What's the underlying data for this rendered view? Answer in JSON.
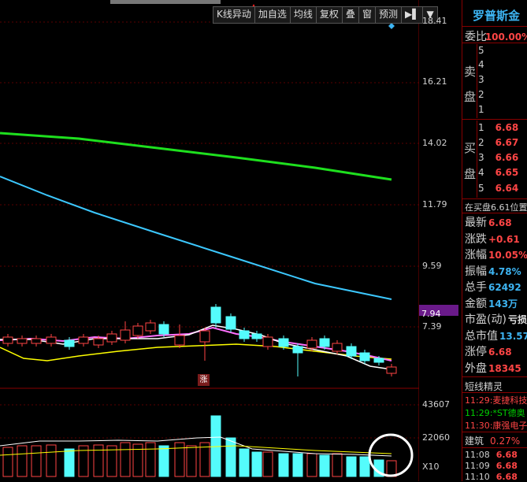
{
  "toolbar": {
    "buttons": [
      "K线异动",
      "加自选",
      "均线",
      "复权",
      "叠",
      "窗",
      "预测"
    ]
  },
  "price_axis": [
    "18.41",
    "16.21",
    "14.02",
    "11.79",
    "9.59",
    "7.39"
  ],
  "current_price_marker": "7.94",
  "volume_axis": [
    "43607",
    "22060",
    "X10"
  ],
  "badge": "涨",
  "stock_name": "罗普斯金",
  "order_book": {
    "weibi_label": "委比",
    "weibi_value": "100.00%",
    "sell_label_1": "卖",
    "sell_label_2": "盘",
    "sell_levels": [
      "5",
      "4",
      "3",
      "2",
      "1"
    ],
    "buy_label_1": "买",
    "buy_label_2": "盘",
    "buy_levels": [
      {
        "n": "1",
        "price": "6.68"
      },
      {
        "n": "2",
        "price": "6.67"
      },
      {
        "n": "3",
        "price": "6.66"
      },
      {
        "n": "4",
        "price": "6.65"
      },
      {
        "n": "5",
        "price": "6.64"
      }
    ],
    "buy_position": "在买盘6.61位置"
  },
  "quote": [
    {
      "label": "最新",
      "value": "6.68",
      "color": "red"
    },
    {
      "label": "涨跌",
      "value": "+0.61",
      "color": "red"
    },
    {
      "label": "涨幅",
      "value": "10.05%",
      "color": "red"
    },
    {
      "label": "振幅",
      "value": "4.78%",
      "color": "cyan"
    },
    {
      "label": "总手",
      "value": "62492",
      "color": "cyan"
    },
    {
      "label": "金额",
      "value": "143万",
      "color": "cyan"
    },
    {
      "label": "市盈(动)",
      "value": "亏损",
      "color": "white"
    },
    {
      "label": "总市值",
      "value": "13.57亿",
      "color": "cyan"
    },
    {
      "label": "涨停",
      "value": "6.68",
      "color": "red"
    },
    {
      "label": "外盘",
      "value": "18345",
      "color": "red"
    }
  ],
  "short_genius": {
    "title": "短线精灵",
    "items": [
      {
        "time": "11:29",
        "text": ":麦捷科技",
        "color": "red"
      },
      {
        "time": "11:29",
        "text": ":*ST德奥",
        "color": "green"
      },
      {
        "time": "11:30",
        "text": ":康强电子",
        "color": "red"
      }
    ]
  },
  "sector": {
    "name": "建筑",
    "value": "0.27%"
  },
  "ticks": [
    {
      "time": "11:08",
      "price": "6.68"
    },
    {
      "time": "11:09",
      "price": "6.68"
    },
    {
      "time": "11:10",
      "price": "6.68"
    },
    {
      "time": "11:12",
      "price": "6.68"
    }
  ],
  "colors": {
    "up": "#ff4545",
    "down": "#54fcfc",
    "ma_green": "#1ee01e",
    "ma_blue": "#3cc8ff",
    "ma_white": "#ffffff",
    "ma_yellow": "#ffff00",
    "ma_pink": "#ff70ff",
    "panel_border": "#800000"
  }
}
